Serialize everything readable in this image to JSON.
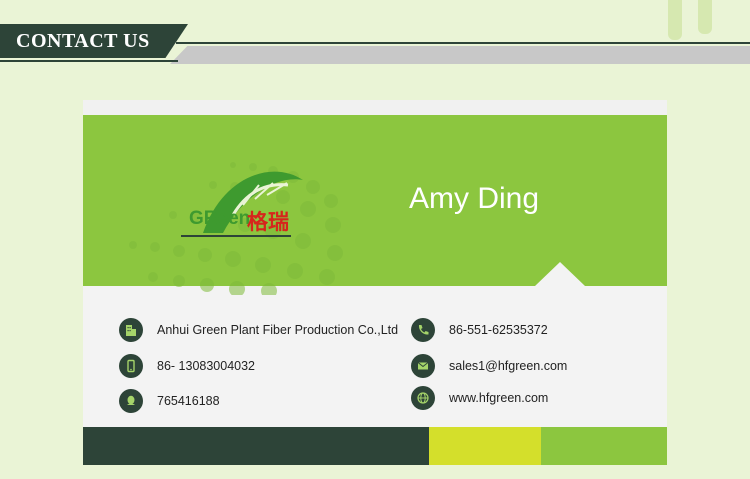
{
  "header": {
    "title": "CONTACT US"
  },
  "card": {
    "name": "Amy Ding",
    "logo": {
      "latin": "GReen",
      "chinese": "格瑞"
    },
    "contacts": {
      "company": "Anhui Green Plant Fiber Production Co.,Ltd",
      "mobile": "86- 13083004032",
      "qq": "765416188",
      "phone": "86-551-62535372",
      "email": "sales1@hfgreen.com",
      "website": "www.hfgreen.com"
    },
    "icons": [
      "building-icon",
      "mobile-icon",
      "qq-icon",
      "phone-icon",
      "mail-icon",
      "globe-icon"
    ]
  },
  "colors": {
    "background": "#eaf4d6",
    "dark_green": "#2d4438",
    "lime": "#8cc63f",
    "yellow_green": "#d4df2b",
    "card_gray": "#f3f3f3"
  }
}
